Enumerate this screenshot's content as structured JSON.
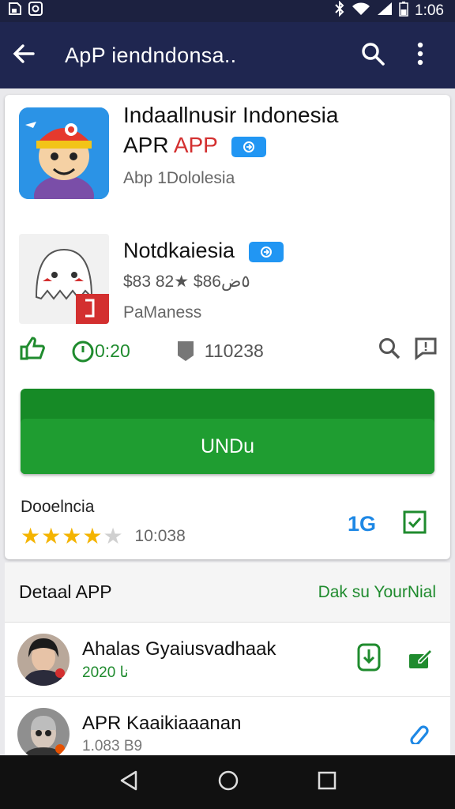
{
  "status_bar": {
    "time": "1:06",
    "left_icons": [
      "sd-card-icon",
      "notification-icon"
    ],
    "right_icons": [
      "bluetooth-icon",
      "wifi-icon",
      "signal-icon",
      "battery-icon"
    ]
  },
  "app_bar": {
    "title": "ApP iendndonsa..",
    "icons": [
      "back-arrow-icon",
      "search-icon",
      "more-vert-icon"
    ]
  },
  "app_header": {
    "title_line1": "Indaallnusir Indonesia",
    "title_line2_part1": "APR",
    "title_line2_part2": "APP",
    "title_line2_part2_color": "#d32f2f",
    "badge_label": "⎋",
    "developer": "Abp 1Dololesia"
  },
  "second_app": {
    "title": "Notdkaiesia",
    "badge_label": "⎋",
    "price": "$83 82★ $86٥ض",
    "publisher": "PaManess"
  },
  "stats": {
    "time": "0:20",
    "downloads": "110238"
  },
  "install_button": {
    "label": "UNDu"
  },
  "rating": {
    "label": "Dooelncia",
    "stars": 4,
    "stars_max": 5,
    "count": "10:038",
    "icon_text": "1G"
  },
  "section": {
    "heading": "Detaal APP",
    "link": "Dak su YourNial"
  },
  "list": [
    {
      "name": "Ahalas Gyaiusvadhaak",
      "sub": "2020 نا"
    },
    {
      "name": "APR Kaaikiaaanan",
      "sub": "1.083 B9"
    }
  ],
  "colors": {
    "app_bar": "#1f2650",
    "accent_green": "#1f9d31",
    "badge_blue": "#2196f3"
  }
}
